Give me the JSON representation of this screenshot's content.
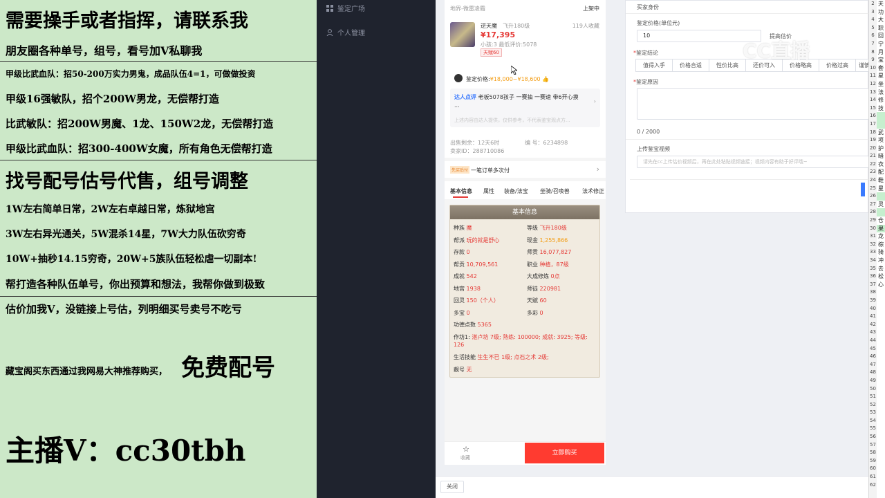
{
  "overlay": {
    "lines": [
      "需要操手或者指挥，请联系我",
      "朋友圈各种单号，组号，看号加Ⅴ私聊我",
      "甲级比武血队：招50-200万实力男鬼，成品队伍4=1，可做做投资",
      "甲级16强敏队，招个200W男龙，无偿帮打造",
      "比武敏队：招200W男魔、1龙、150W2龙，无偿帮打造",
      "甲级比武血队：招300-400W女魔，所有角色无偿帮打造",
      "找号配号估号代售，组号调整",
      "1W左右简单日常，2W左右卓越日常，炼狱地宫",
      "3W左右异光通关，5W混杀14星，7W大力队伍砍穷奇",
      "10W+抽秒14.15穷奇，20W+5族队伍轻松虐一切副本!",
      "帮打造各种队伍单号，你出预算和想法，我帮你做到极致",
      "估价加我Ⅴ，没链接上号估，列明细买号卖号不吃亏",
      "藏宝阁买东西通过我网易大神推荐购买，",
      "免费配号",
      "主播Ⅴ：cc30tbh"
    ]
  },
  "sidebar": {
    "items": [
      {
        "label": "鉴定广场",
        "icon": "grid-icon"
      },
      {
        "label": "个人管理",
        "icon": "user-icon"
      }
    ]
  },
  "phone": {
    "server": "地界-微雷凌霜",
    "status": "上架中",
    "role_name": "逆天魔",
    "level": "飞升180级",
    "watch_count": "119人收藏",
    "price": "¥17,395",
    "sub_info": "小孩:3 最低评价:5078",
    "tag": "天赋60",
    "appraisal_label": "鉴定价格:",
    "appraisal_range": "¥18,000~¥18,600",
    "review_badge": "达人点评",
    "review_text": "老板5078孩子 一赛抽 一赛速 带6开心摸",
    "review_more": "...",
    "disclaimer": "上述内容由达人提供，仅供参考，不代表鉴宝观点方...",
    "time_left": "出售剩余：12天6时",
    "seller_id": "卖家ID：288710086",
    "item_no_label": "编 号：",
    "item_no": "6234898",
    "promo_badge": "先买后付",
    "promo_text": "一笔订单多次付",
    "tabs": [
      "基本信息",
      "属性",
      "装备/法宝",
      "坐骑/召唤兽",
      "法术修正"
    ],
    "card_title": "基本信息",
    "fields": [
      {
        "k": "种族",
        "v": "魔",
        "k2": "等级",
        "v2": "飞升180级"
      },
      {
        "k": "帮派",
        "v": "玩的就是舒心",
        "k2": "现金",
        "v2": "1,255,866"
      },
      {
        "k": "存款",
        "v": "0",
        "k2": "师贡",
        "v2": "16,077,827"
      },
      {
        "k": "帮贡",
        "v": "10,709,561",
        "k2": "职业",
        "v2": "种植，87级"
      },
      {
        "k": "成就",
        "v": "542",
        "k2": "大成修炼",
        "v2": "0点"
      },
      {
        "k": "地宫",
        "v": "1938",
        "k2": "师徒",
        "v2": "220981"
      },
      {
        "k": "回灵",
        "v": "150（个人）",
        "k2": "天赋",
        "v2": "60"
      },
      {
        "k": "多宝",
        "v": "0",
        "k2": "多彩",
        "v2": "0"
      }
    ],
    "merit_label": "功德点数",
    "merit": "5365",
    "workshop_label": "作坊1:",
    "workshop": "湛卢坊 7级; 熟练: 100000; 成就: 3925; 等级: 126",
    "skill_label": "生活技能",
    "skill": "生生不已 1级; 点石之术 2级;",
    "pretty_label": "靓号",
    "pretty": "无",
    "fav_label": "收藏",
    "buy_label": "立即购买"
  },
  "form": {
    "title": "买家身份",
    "price_label": "鉴定价格(单位元)",
    "price_value": "10",
    "estimate_hint": "提高估价",
    "conclusion_label": "鉴定结论",
    "conclusions": [
      "值得入手",
      "价格合适",
      "性价比高",
      "还价可入",
      "价格略高",
      "价格过高",
      "谨慎"
    ],
    "reason_label": "鉴定原因",
    "counter": "0 / 2000",
    "video_label": "上传鉴宝视频",
    "video_placeholder": "请先在cc上传估价视频后，再在此处粘贴视频链接；视频内容有助于好评哦~"
  },
  "watermark": "CC直播",
  "footer": {
    "close_label": "关闭"
  },
  "sheet": {
    "rows": [
      "2",
      "3",
      "4",
      "5",
      "6",
      "7",
      "8",
      "9",
      "10",
      "11",
      "12",
      "13",
      "14",
      "15",
      "16",
      "17",
      "18",
      "19",
      "20",
      "21",
      "22",
      "23",
      "24",
      "25",
      "26",
      "27",
      "28",
      "29",
      "30",
      "31",
      "32",
      "33",
      "34",
      "35",
      "36",
      "37",
      "38",
      "39",
      "40",
      "41",
      "42",
      "43",
      "44",
      "45",
      "46",
      "47",
      "48",
      "49",
      "50",
      "51",
      "52",
      "53",
      "54",
      "55",
      "56",
      "57",
      "58",
      "59",
      "60",
      "61",
      "62"
    ],
    "cells": [
      "天",
      "功",
      "大",
      "职",
      "回",
      "宁",
      "月",
      "宝",
      "套",
      "星",
      "坐",
      "法",
      "修",
      "技",
      "",
      "",
      "武",
      "项",
      "护",
      "暗",
      "衣",
      "配",
      "鞋",
      "星",
      "",
      "灵",
      "",
      "仓",
      "果",
      "龙",
      "棕",
      "骑",
      "冲",
      "去",
      "松",
      "心"
    ]
  },
  "colors": {
    "accent": "#e53935",
    "overlay_bg": "#cce8c8",
    "sidebar_bg": "#1f232e"
  }
}
